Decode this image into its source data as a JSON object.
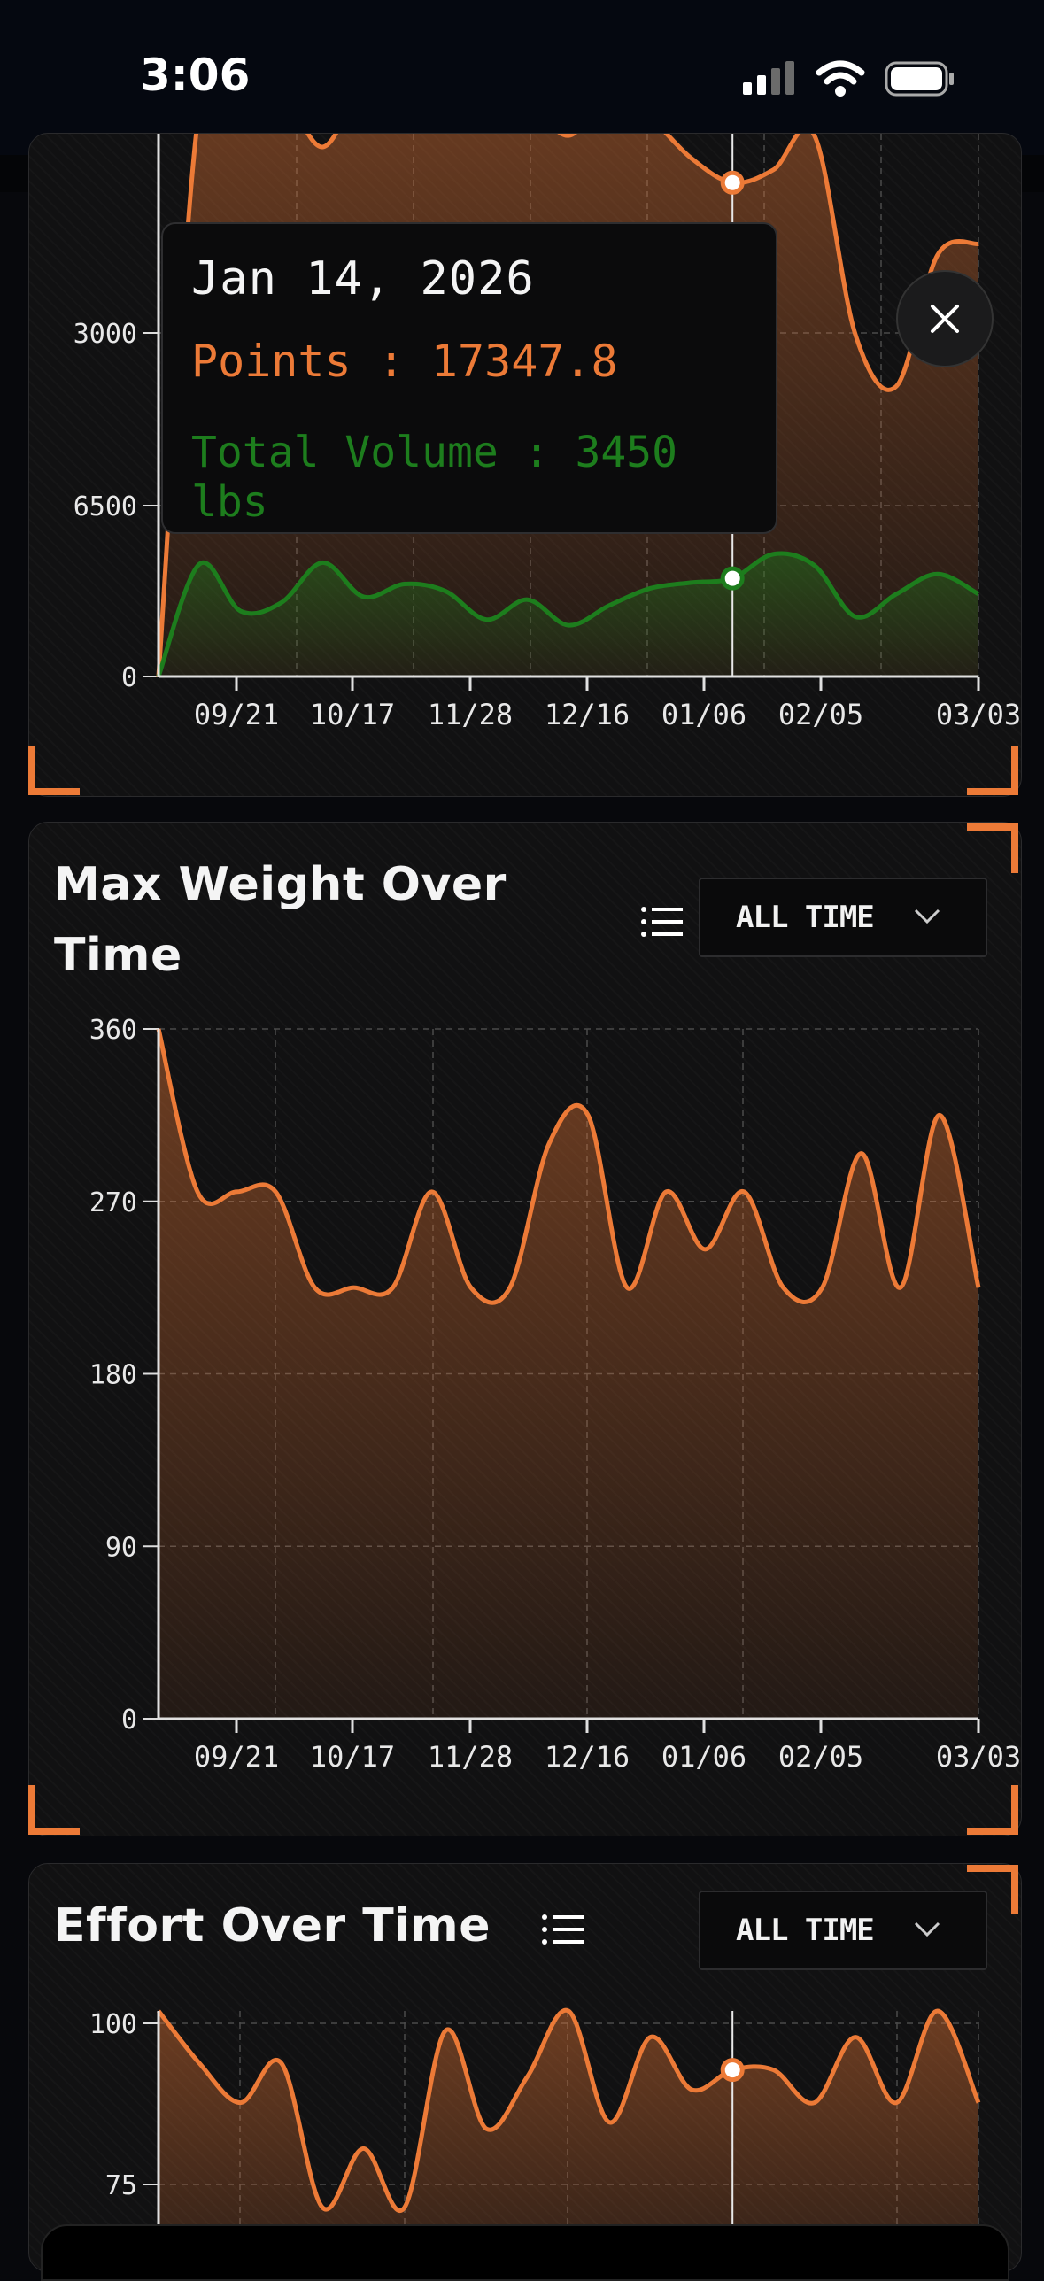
{
  "status_bar": {
    "time": "3:06"
  },
  "tooltip": {
    "date": "Jan 14, 2026",
    "points_label": "Points : 17347.8",
    "volume_label": "Total Volume : 3450 lbs",
    "points_color": "#ec7a37",
    "volume_color": "#1d7d1d"
  },
  "cards": {
    "max_weight": {
      "title_line1": "Max Weight Over",
      "title_line2": "Time",
      "range": "ALL TIME"
    },
    "effort": {
      "title": "Effort Over Time",
      "range": "ALL TIME"
    }
  },
  "colors": {
    "accent": "#ec7a37",
    "volume": "#1d7d1d",
    "card_bg": "#111112"
  },
  "chart_data": [
    {
      "type": "area",
      "partially_visible": true,
      "x_ticks": [
        "09/21",
        "10/17",
        "11/28",
        "12/16",
        "01/06",
        "02/05",
        "03/03"
      ],
      "y_ticks": [
        "0",
        "6500",
        "3000"
      ],
      "ylim": [
        0,
        20000
      ],
      "series": [
        {
          "name": "Points",
          "color": "#ec7a37",
          "values": [
            0,
            20000,
            19400,
            20400,
            18600,
            20600,
            19800,
            20200,
            20600,
            20200,
            19000,
            20400,
            19600,
            18200,
            17347.8,
            17800,
            19000,
            12000,
            10200,
            14800,
            15200
          ]
        },
        {
          "name": "Total Volume",
          "color": "#1d7d1d",
          "values": [
            0,
            3950,
            2300,
            2600,
            4000,
            2800,
            3250,
            3000,
            2000,
            2700,
            1800,
            2500,
            3100,
            3300,
            3450,
            4300,
            3900,
            2100,
            2900,
            3600,
            2900
          ]
        }
      ],
      "highlight": {
        "date": "Jan 14, 2026",
        "index": 14
      }
    },
    {
      "type": "area",
      "title": "Max Weight Over Time",
      "x_ticks": [
        "09/21",
        "10/17",
        "11/28",
        "12/16",
        "01/06",
        "02/05",
        "03/03"
      ],
      "y_ticks": [
        "0",
        "90",
        "180",
        "270",
        "360"
      ],
      "ylim": [
        0,
        360
      ],
      "series": [
        {
          "color": "#ec7a37",
          "values": [
            360,
            275,
            275,
            275,
            225,
            225,
            225,
            275,
            225,
            225,
            300,
            315,
            225,
            275,
            245,
            275,
            225,
            225,
            295,
            225,
            315,
            225
          ]
        }
      ]
    },
    {
      "type": "area",
      "title": "Effort Over Time",
      "partially_visible": true,
      "y_ticks": [
        "75",
        "100"
      ],
      "ylim": [
        50,
        100
      ],
      "series": [
        {
          "color": "#ec7a37",
          "values": [
            100,
            92,
            86,
            92,
            70,
            79,
            70,
            97,
            82,
            90,
            100,
            83,
            96,
            88,
            91,
            91,
            86,
            96,
            86,
            100,
            86
          ]
        }
      ],
      "highlight": {
        "index": 14,
        "value": 91
      }
    }
  ]
}
